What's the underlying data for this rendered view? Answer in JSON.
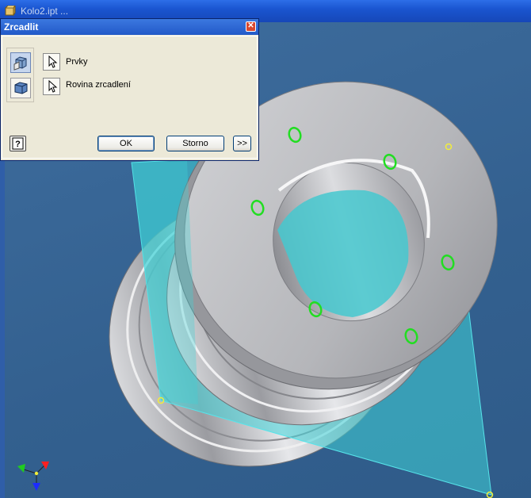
{
  "app": {
    "doc_title": "Kolo2.ipt ..."
  },
  "dialog": {
    "title": "Zrcadlit",
    "selectors": [
      {
        "label": "Prvky"
      },
      {
        "label": "Rovina zrcadlení"
      }
    ],
    "buttons": {
      "ok": "OK",
      "cancel": "Storno",
      "more": ">>"
    }
  },
  "colors": {
    "viewport_bg": "#3d6a9a",
    "mirror_plane": "#3fd3d8",
    "part_grey": "#b8b9bd",
    "hole_highlight": "#22dd22",
    "plane_corner": "#f2ee3a"
  },
  "icons": [
    "document-icon",
    "close-icon",
    "mirror-features-icon",
    "mirror-plane-icon",
    "cursor-arrow-icon",
    "help-icon",
    "axis-triad-icon"
  ]
}
